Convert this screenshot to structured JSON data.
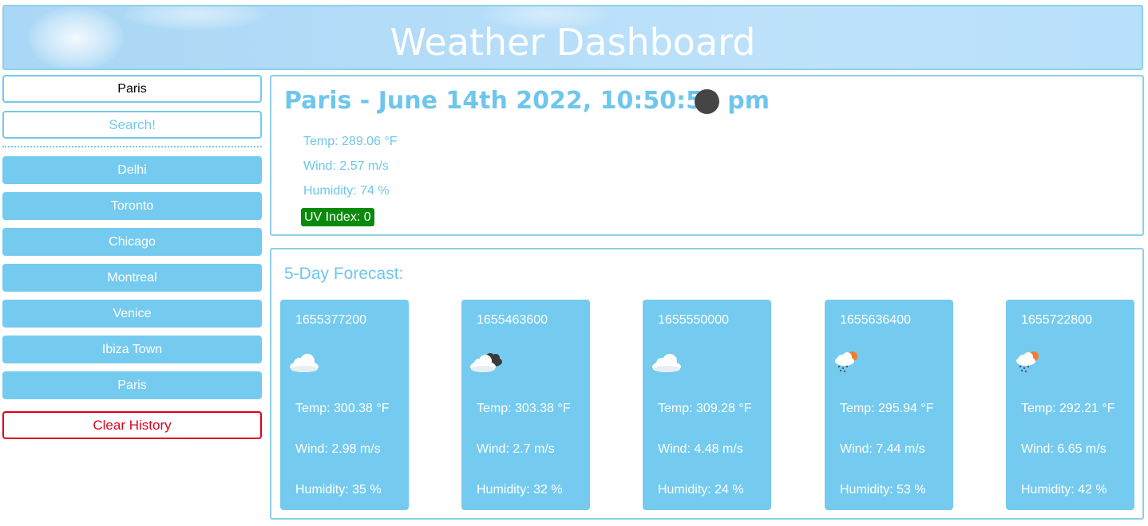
{
  "header": {
    "title": "Weather Dashboard"
  },
  "sidebar": {
    "search_value": "Paris",
    "search_button": "Search!",
    "history": [
      "Delhi",
      "Toronto",
      "Chicago",
      "Montreal",
      "Venice",
      "Ibiza Town",
      "Paris"
    ],
    "clear_button": "Clear History"
  },
  "current": {
    "title": "Paris - June 14th 2022, 10:50:52 pm",
    "icon": "moon-icon",
    "temp": "Temp: 289.06 °F",
    "wind": "Wind: 2.57 m/s",
    "humidity": "Humidity: 74 %",
    "uv": "UV Index: 0",
    "uv_color": "#0a8a0a"
  },
  "forecast": {
    "title": "5-Day Forecast:",
    "days": [
      {
        "date": "1655377200",
        "icon": "cloud-icon",
        "temp": "Temp: 300.38 °F",
        "wind": "Wind: 2.98 m/s",
        "humidity": "Humidity: 35 %"
      },
      {
        "date": "1655463600",
        "icon": "broken-clouds-icon",
        "temp": "Temp: 303.38 °F",
        "wind": "Wind: 2.7 m/s",
        "humidity": "Humidity: 32 %"
      },
      {
        "date": "1655550000",
        "icon": "cloud-icon",
        "temp": "Temp: 309.28 °F",
        "wind": "Wind: 4.48 m/s",
        "humidity": "Humidity: 24 %"
      },
      {
        "date": "1655636400",
        "icon": "rain-sun-icon",
        "temp": "Temp: 295.94 °F",
        "wind": "Wind: 7.44 m/s",
        "humidity": "Humidity: 53 %"
      },
      {
        "date": "1655722800",
        "icon": "rain-sun-icon",
        "temp": "Temp: 292.21 °F",
        "wind": "Wind: 6.65 m/s",
        "humidity": "Humidity: 42 %"
      }
    ]
  },
  "colors": {
    "accent": "#75cbef",
    "danger": "#e0001b"
  }
}
